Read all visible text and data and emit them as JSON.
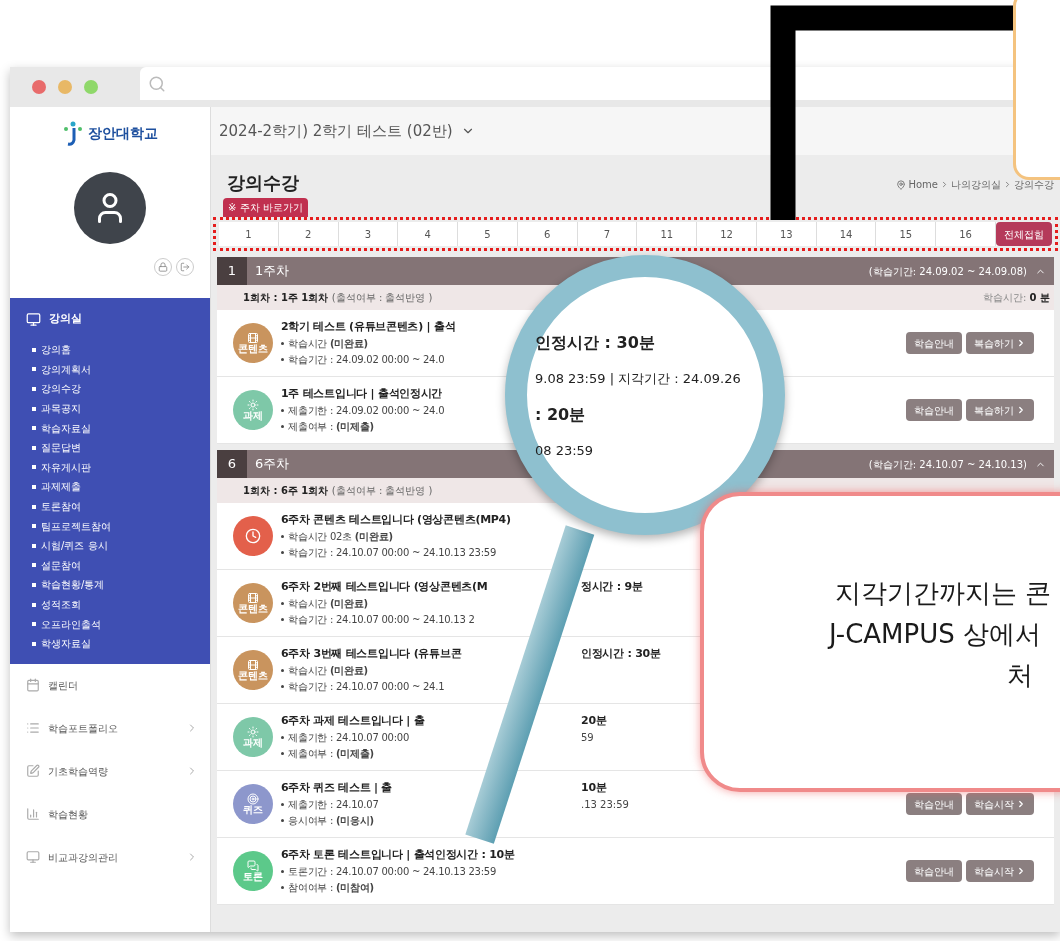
{
  "browser": {
    "dots": [
      {
        "color": "#e86b6b"
      },
      {
        "color": "#e8b866"
      },
      {
        "color": "#8fd86a"
      }
    ]
  },
  "sidebar": {
    "logo": "장안대학교",
    "menu_title": "강의실",
    "menu_items": [
      "강의홈",
      "강의계획서",
      "강의수강",
      "과목공지",
      "학습자료실",
      "질문답변",
      "자유게시판",
      "과제제출",
      "토론참여",
      "팀프로젝트참여",
      "시험/퀴즈 응시",
      "설문참여",
      "학습현황/통계",
      "성적조회",
      "오프라인출석",
      "학생자료실"
    ],
    "links": [
      {
        "kind": "calendar",
        "label": "캘린더",
        "has_children": false
      },
      {
        "kind": "list",
        "label": "학습포트폴리오",
        "has_children": true
      },
      {
        "kind": "edit",
        "label": "기초학습역량",
        "has_children": true
      },
      {
        "kind": "chart",
        "label": "학습현황",
        "has_children": false
      },
      {
        "kind": "monitor",
        "label": "비교과강의관리",
        "has_children": true
      }
    ]
  },
  "course": {
    "title": "2024-2학기) 2학기 테스트 (02반)"
  },
  "page": {
    "title": "강의수강",
    "breadcrumb": [
      "Home",
      "나의강의실",
      "강의수강"
    ],
    "week_nav_label": "※ 주차 바로가기",
    "weeks": [
      "1",
      "2",
      "3",
      "4",
      "5",
      "6",
      "7",
      "11",
      "12",
      "13",
      "14",
      "15",
      "16"
    ],
    "collapse_all": "전체접힘"
  },
  "sections": [
    {
      "number": "1",
      "title": "1주차",
      "period": "(학습기간: 24.09.02 ~ 24.09.08)",
      "expanded": true,
      "session": "1회차 : 1주 1회차",
      "session_note": "(출석여부 : 출석반영 )",
      "study_time_label": "학습시간:",
      "study_time": "0 분",
      "items": [
        {
          "kind": "content",
          "icon_label": "콘텐츠",
          "title": "2학기 테스트 (유튜브콘텐츠) | 출석",
          "lines": [
            {
              "text": "학습시간 **(미완료)**"
            },
            {
              "text": "학습기간 : 24.09.02 00:00 ~ 24.0"
            }
          ],
          "buttons": [
            "학습안내",
            "복습하기"
          ]
        },
        {
          "kind": "task",
          "icon_label": "과제",
          "title": "1주 테스트입니다 | 출석인정시간",
          "lines": [
            {
              "text": "제출기한 : 24.09.02 00:00 ~ 24.0"
            },
            {
              "text": "제출여부 : **(미제출)**"
            }
          ],
          "buttons": [
            "학습안내",
            "복습하기"
          ]
        }
      ]
    },
    {
      "number": "6",
      "title": "6주차",
      "period": "(학습기간: 24.10.07 ~ 24.10.13)",
      "expanded": true,
      "session": "1회차 : 6주 1회차",
      "session_note": "(출석여부 : 출석반영 )",
      "items": [
        {
          "kind": "video",
          "title": "6주차 콘텐츠 테스트입니다 (영상콘텐츠(MP4)",
          "lines": [
            {
              "text": "학습시간 02초 **(미완료)**"
            },
            {
              "text": "학습기간 : 24.10.07 00:00 ~ 24.10.13 23:59"
            }
          ]
        },
        {
          "kind": "content",
          "icon_label": "콘텐츠",
          "title": "6주차 2번째 테스트입니다 (영상콘텐츠(M",
          "title_tail": "정시간 : 9분",
          "lines": [
            {
              "text": "학습시간 **(미완료)**"
            },
            {
              "text": "학습기간 : 24.10.07 00:00 ~ 24.10.13 2"
            }
          ]
        },
        {
          "kind": "content",
          "icon_label": "콘텐츠",
          "title": "6주차 3번째 테스트입니다 (유튜브콘",
          "title_tail": "인정시간 : 30분",
          "lines": [
            {
              "text": "학습시간 **(미완료)**"
            },
            {
              "text": "학습기간 : 24.10.07 00:00 ~ 24.1"
            }
          ]
        },
        {
          "kind": "task",
          "icon_label": "과제",
          "title": "6주차 과제 테스트입니다 | 출",
          "title_tail": "20분",
          "lines": [
            {
              "text": "제출기한 : 24.10.07 00:00",
              "tail": "59"
            },
            {
              "text": "제출여부 : **(미제출)**"
            }
          ]
        },
        {
          "kind": "quiz",
          "icon_label": "퀴즈",
          "title": "6주차 퀴즈 테스트 | 출",
          "title_tail": "10분",
          "lines": [
            {
              "text": "제출기한 : 24.10.07",
              "tail": ".13 23:59"
            },
            {
              "text": "응시여부 : **(미응시)**"
            }
          ],
          "buttons": [
            "학습안내",
            "학습시작"
          ]
        },
        {
          "kind": "discussion",
          "icon_label": "토론",
          "title": "6주차 토론 테스트입니다 | 출석인정시간 : 10분",
          "lines": [
            {
              "text": "토론기간 : 24.10.07 00:00 ~ 24.10.13 23:59"
            },
            {
              "text": "참여여부 : **(미참여)**"
            }
          ],
          "buttons": [
            "학습안내",
            "학습시작"
          ]
        }
      ]
    }
  ],
  "magnifier": {
    "lines": [
      "인정시간 : 30분",
      "9.08 23:59 | 지각기간 : 24.09.26",
      ": 20분",
      "08 23:59"
    ]
  },
  "callout": {
    "lines": [
      "지각기간까지는 콘",
      "J-CAMPUS 상에서",
      "처"
    ]
  }
}
